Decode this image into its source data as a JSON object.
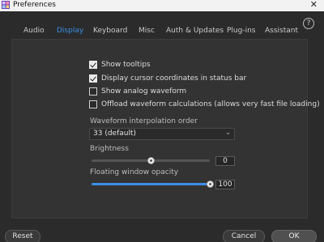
{
  "window": {
    "title": "Preferences",
    "close_glyph": "✕",
    "app_icon": "grid-app-icon"
  },
  "tabs": [
    {
      "label": "Audio",
      "active": false
    },
    {
      "label": "Display",
      "active": true
    },
    {
      "label": "Keyboard",
      "active": false
    },
    {
      "label": "Misc",
      "active": false
    },
    {
      "label": "Auth & Updates",
      "active": false
    },
    {
      "label": "Plug-ins",
      "active": false
    },
    {
      "label": "Assistant",
      "active": false
    }
  ],
  "help": {
    "glyph": "?"
  },
  "options": [
    {
      "label": "Show tooltips",
      "checked": true
    },
    {
      "label": "Display cursor coordinates in status bar",
      "checked": true
    },
    {
      "label": "Show analog waveform",
      "checked": false
    },
    {
      "label": "Offload waveform calculations (allows very fast file loading)",
      "checked": false
    }
  ],
  "interpolation": {
    "label": "Waveform interpolation order",
    "value": "33 (default)",
    "arrow": "⌄"
  },
  "brightness": {
    "label": "Brightness",
    "value": "0",
    "fraction": 0.5
  },
  "opacity": {
    "label": "Floating window opacity",
    "value": "100",
    "fraction": 1.0
  },
  "footer": {
    "reset_label": "Reset",
    "cancel_label": "Cancel",
    "ok_label": "OK"
  },
  "colors": {
    "accent": "#3b8fe8",
    "background": "#2b2b2b",
    "panel": "#333333"
  }
}
